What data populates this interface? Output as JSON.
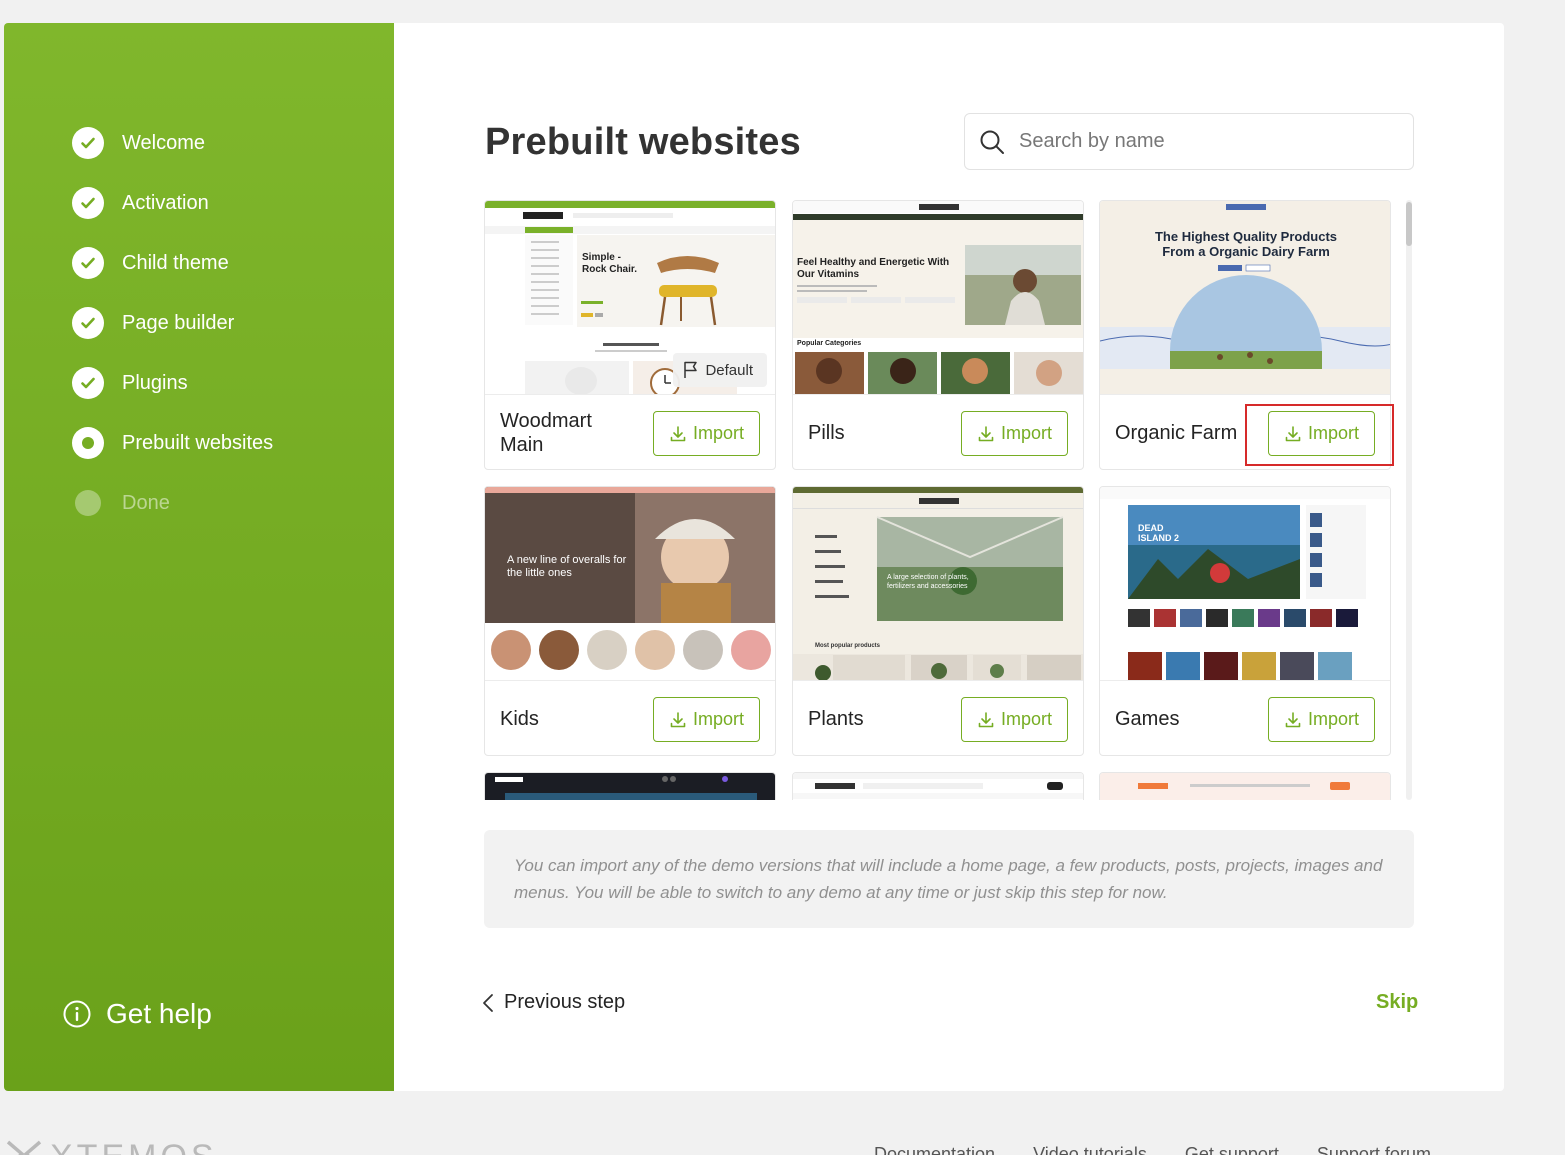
{
  "sidebar": {
    "steps": [
      {
        "label": "Welcome",
        "state": "done"
      },
      {
        "label": "Activation",
        "state": "done"
      },
      {
        "label": "Child theme",
        "state": "done"
      },
      {
        "label": "Page builder",
        "state": "done"
      },
      {
        "label": "Plugins",
        "state": "done"
      },
      {
        "label": "Prebuilt websites",
        "state": "current"
      },
      {
        "label": "Done",
        "state": "pending"
      }
    ],
    "help_label": "Get help"
  },
  "main": {
    "title": "Prebuilt websites",
    "search_placeholder": "Search by name",
    "default_badge": "Default",
    "import_label": "Import",
    "cards": [
      {
        "name": "Woodmart Main",
        "theme": "woodmart",
        "hero_text": "Simple - Rock Chair.",
        "sub_text": "FEATURED CATEGORIES"
      },
      {
        "name": "Pills",
        "theme": "pills",
        "hero_text": "Feel Healthy and Energetic With Our Vitamins",
        "sub_text": "Popular Categories"
      },
      {
        "name": "Organic Farm",
        "theme": "farm",
        "hero_text": "The Highest Quality Products From a Organic Dairy Farm"
      },
      {
        "name": "Kids",
        "theme": "kids",
        "hero_text": "A new line of overalls for the little ones"
      },
      {
        "name": "Plants",
        "theme": "plants",
        "hero_text": "A large selection of plants, fertilizers and accessories",
        "sub_text": "Most popular products"
      },
      {
        "name": "Games",
        "theme": "games",
        "hero_text": "DEAD ISLAND 2"
      },
      {
        "name": "",
        "theme": "dark"
      },
      {
        "name": "",
        "theme": "store"
      },
      {
        "name": "",
        "theme": "pinkstore"
      }
    ],
    "note": "You can import any of the demo versions that will include a home page, a few products, posts, projects, images and menus. You will be able to switch to any demo at any time or just skip this step for now.",
    "prev_label": "Previous step",
    "skip_label": "Skip"
  },
  "footer": {
    "logo_text": "XTEMOS",
    "links": [
      "Documentation",
      "Video tutorials",
      "Get support",
      "Support forum"
    ]
  },
  "colors": {
    "accent": "#76ad23",
    "sidebar_top": "#80b72c",
    "sidebar_bottom": "#6aa11a",
    "highlight": "#d62a2a"
  }
}
